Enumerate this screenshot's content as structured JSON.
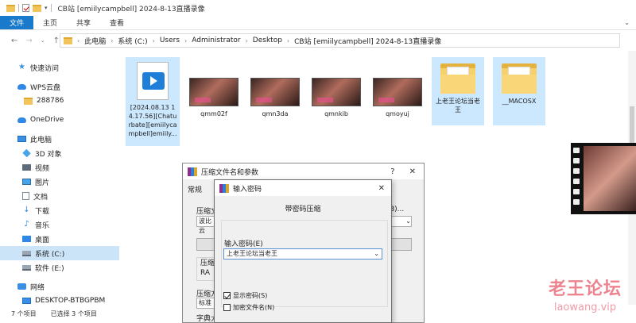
{
  "window": {
    "title": "CB站 [emiilycampbell] 2024-8-13直播录像"
  },
  "ribbon": {
    "tabs": [
      "文件",
      "主页",
      "共享",
      "查看"
    ],
    "active_tab": "文件",
    "accent": "#1979ca"
  },
  "address": {
    "crumbs": [
      "此电脑",
      "系统 (C:)",
      "Users",
      "Administrator",
      "Desktop",
      "CB站 [emiilycampbell] 2024-8-13直播录像"
    ]
  },
  "sidebar": {
    "items": [
      {
        "label": "快速访问",
        "icon": "star-icon"
      },
      {
        "label": "WPS云盘",
        "icon": "cloud-icon"
      },
      {
        "label": "288786",
        "icon": "folder-icon"
      },
      {
        "label": "OneDrive",
        "icon": "cloud-icon"
      },
      {
        "label": "此电脑",
        "icon": "computer-icon"
      },
      {
        "label": "3D 对象",
        "icon": "cube-icon"
      },
      {
        "label": "视频",
        "icon": "video-icon"
      },
      {
        "label": "图片",
        "icon": "picture-icon"
      },
      {
        "label": "文档",
        "icon": "document-icon"
      },
      {
        "label": "下载",
        "icon": "download-icon"
      },
      {
        "label": "音乐",
        "icon": "music-icon"
      },
      {
        "label": "桌面",
        "icon": "desktop-icon"
      },
      {
        "label": "系统 (C:)",
        "icon": "drive-icon"
      },
      {
        "label": "软件 (E:)",
        "icon": "drive-icon"
      },
      {
        "label": "网络",
        "icon": "network-icon"
      },
      {
        "label": "DESKTOP-BTBGPBM",
        "icon": "computer-icon"
      }
    ],
    "selected": "系统 (C:)"
  },
  "files": [
    {
      "name": "[2024.08.13 14.17.56][Chaturbate][emiilycampbell]emiily...",
      "type": "video"
    },
    {
      "name": "qmm02f",
      "type": "thumbnail"
    },
    {
      "name": "qmn3da",
      "type": "thumbnail"
    },
    {
      "name": "qmnkib",
      "type": "thumbnail"
    },
    {
      "name": "qmoyuj",
      "type": "thumbnail"
    },
    {
      "name": "上老王论坛当老王",
      "type": "folder"
    },
    {
      "name": "__MACOSX",
      "type": "folder"
    }
  ],
  "status": {
    "count": "7 个项目",
    "selected": "已选择 3 个项目"
  },
  "archive_dialog": {
    "title": "压缩文件名和参数",
    "help": "?",
    "close": "✕",
    "tab": "常规",
    "labels": [
      "压缩文",
      "压缩",
      "RA",
      "压缩方",
      "标准",
      "字典大"
    ],
    "field_prefix": "波比云",
    "right_text": "B)..."
  },
  "password_dialog": {
    "title": "输入密码",
    "close": "✕",
    "heading": "带密码压缩",
    "input_label": "输入密码(E)",
    "input_value": "上老王论坛当老王",
    "show_password": "显示密码(S)",
    "show_password_checked": true,
    "encrypt_names": "加密文件名(N)",
    "encrypt_names_checked": false
  },
  "watermark": {
    "cn": "老王论坛",
    "en": "laowang.vip"
  }
}
